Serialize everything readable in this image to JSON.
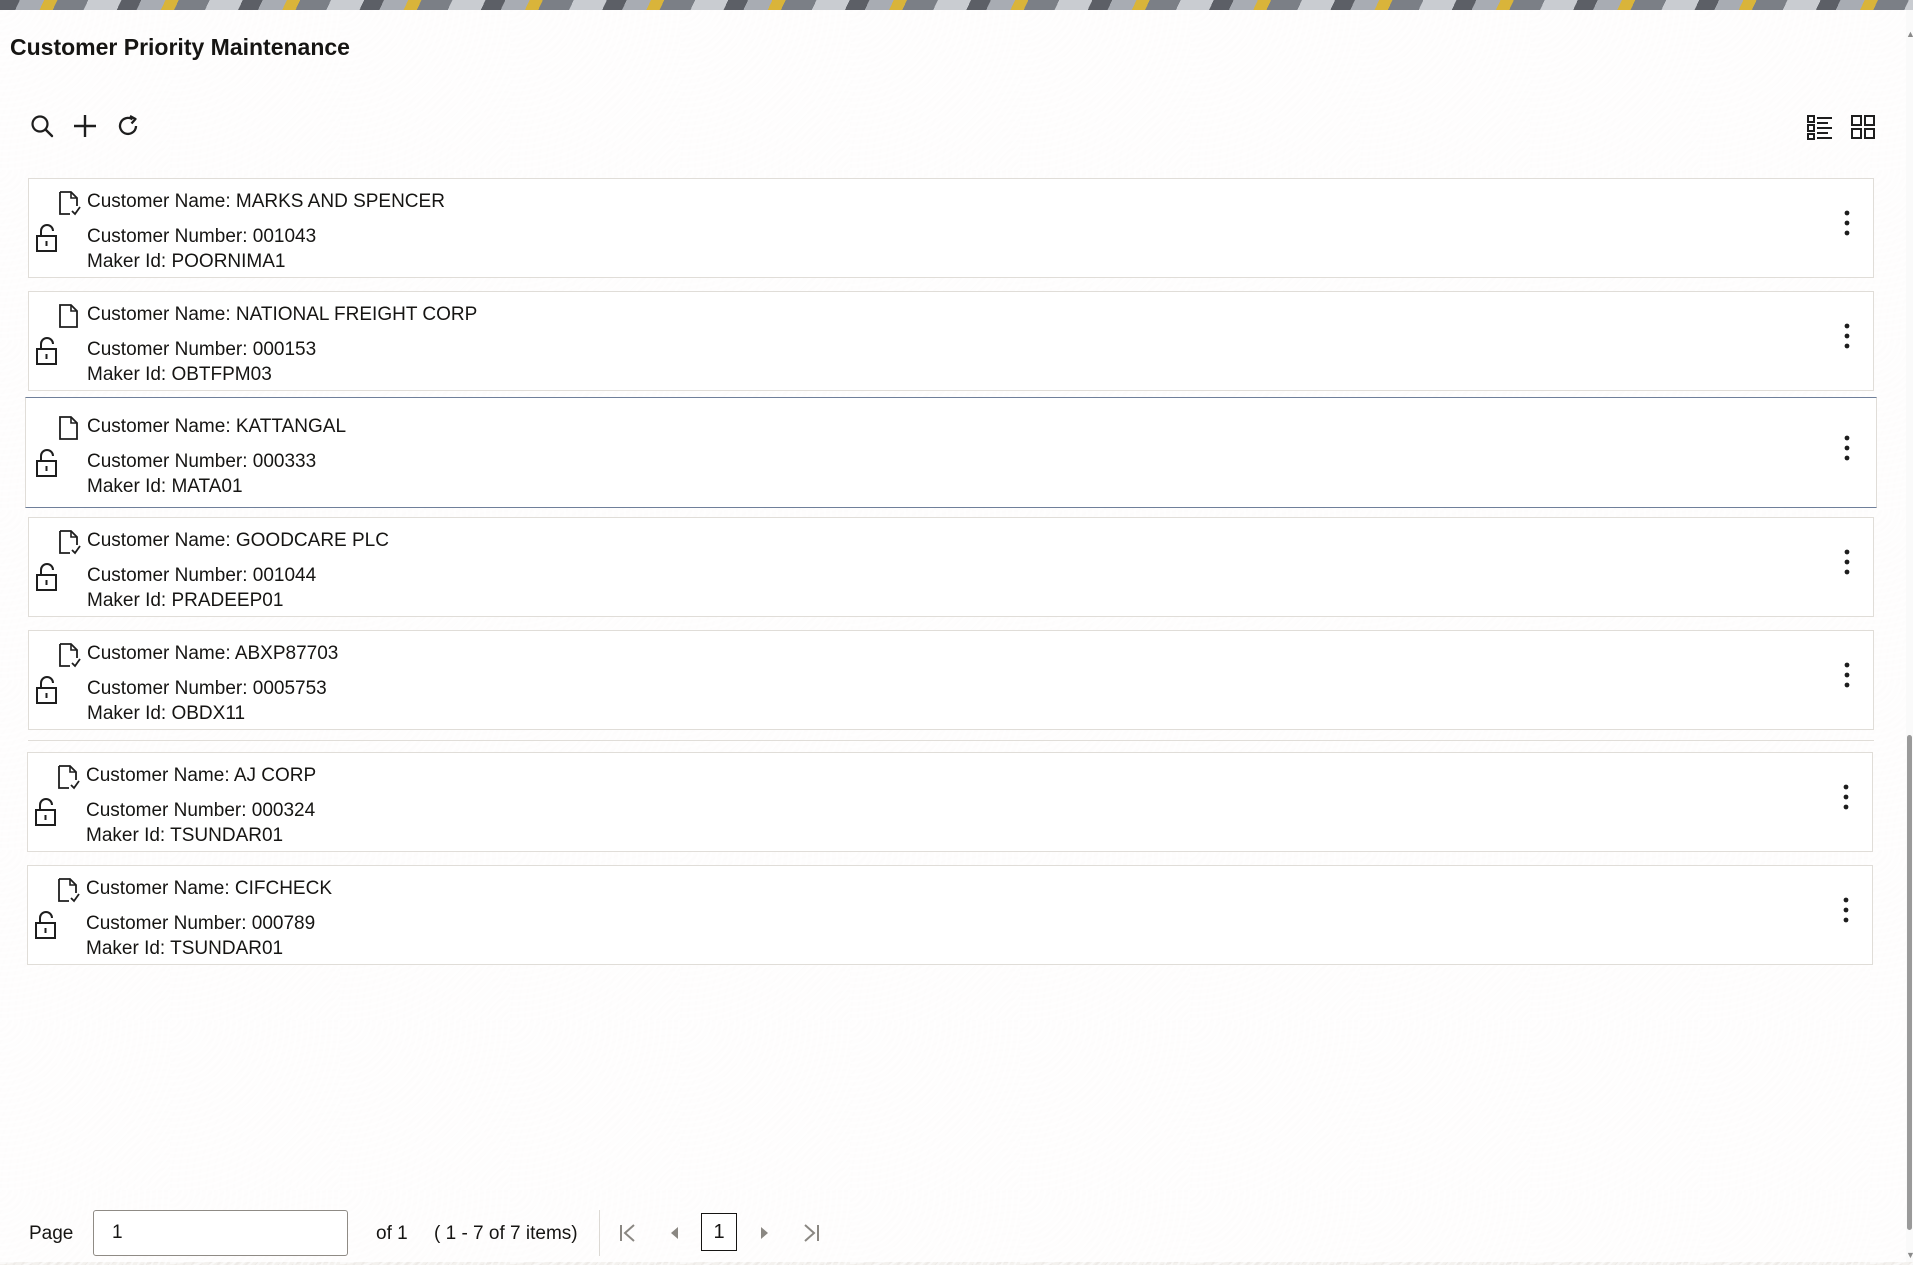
{
  "page": {
    "title": "Customer Priority Maintenance"
  },
  "toolbar": {
    "icons": [
      "search-icon",
      "add-icon",
      "refresh-icon"
    ],
    "view_icons": [
      "list-view-icon",
      "grid-view-icon"
    ]
  },
  "records": [
    {
      "name_label": "Customer Name: MARKS AND SPENCER",
      "number_label": "Customer Number: 001043",
      "maker_label": "Maker Id: POORNIMA1",
      "doc_icon": "document-check-icon",
      "lock_icon": "unlock-icon"
    },
    {
      "name_label": "Customer Name: NATIONAL FREIGHT CORP",
      "number_label": "Customer Number: 000153",
      "maker_label": "Maker Id: OBTFPM03",
      "doc_icon": "document-icon",
      "lock_icon": "unlock-icon"
    },
    {
      "name_label": "Customer Name: KATTANGAL",
      "number_label": "Customer Number: 000333",
      "maker_label": "Maker Id: MATA01",
      "doc_icon": "document-icon",
      "lock_icon": "unlock-icon"
    },
    {
      "name_label": "Customer Name: GOODCARE PLC",
      "number_label": "Customer Number: 001044",
      "maker_label": "Maker Id: PRADEEP01",
      "doc_icon": "document-check-icon",
      "lock_icon": "unlock-icon"
    },
    {
      "name_label": "Customer Name: ABXP87703",
      "number_label": "Customer Number: 0005753",
      "maker_label": "Maker Id: OBDX11",
      "doc_icon": "document-check-icon",
      "lock_icon": "unlock-icon"
    },
    {
      "name_label": "Customer Name: AJ CORP",
      "number_label": "Customer Number: 000324",
      "maker_label": "Maker Id: TSUNDAR01",
      "doc_icon": "document-check-icon",
      "lock_icon": "unlock-icon"
    },
    {
      "name_label": "Customer Name: CIFCHECK",
      "number_label": "Customer Number: 000789",
      "maker_label": "Maker Id: TSUNDAR01",
      "doc_icon": "document-check-icon",
      "lock_icon": "unlock-icon"
    }
  ],
  "pagination": {
    "page_label": "Page",
    "page_input_value": "1",
    "of_total": "of 1",
    "range": "( 1 - 7 of 7 items)",
    "current_page": "1",
    "icons": [
      "first-page-icon",
      "previous-page-icon",
      "next-page-icon",
      "last-page-icon"
    ]
  },
  "colors": {
    "text": "#161513",
    "icon": "#1e1e1e",
    "selected_border": "#6f7f9a",
    "card_border": "#e0ddd8"
  }
}
